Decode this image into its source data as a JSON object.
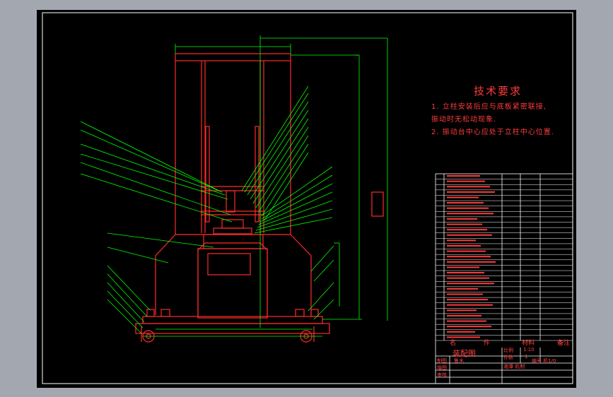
{
  "technical_requirements": {
    "title": "技术要求",
    "items": [
      "1. 立柱安装后应与底板紧密联接,",
      "振动时无松动现象.",
      "2. 振动台中心应处于立柱中心位置."
    ]
  },
  "title_block": {
    "drawing_name": "装配图",
    "header": [
      "名",
      "件",
      "材料",
      "备注"
    ],
    "scale_label": "比例",
    "scale_value": "1:10",
    "count_label": "件数",
    "count_value": "1",
    "left_labels": [
      "制图",
      "描图",
      "审核"
    ],
    "drafter": "鲁木",
    "school": "湘潭 机制",
    "drawing_no": "编号 机1/0"
  },
  "colors": {
    "background": "#000000",
    "frame": "#ffffff",
    "outline": "#ff2a2a",
    "dimension": "#00ff00",
    "text": "#ff3b3b"
  }
}
